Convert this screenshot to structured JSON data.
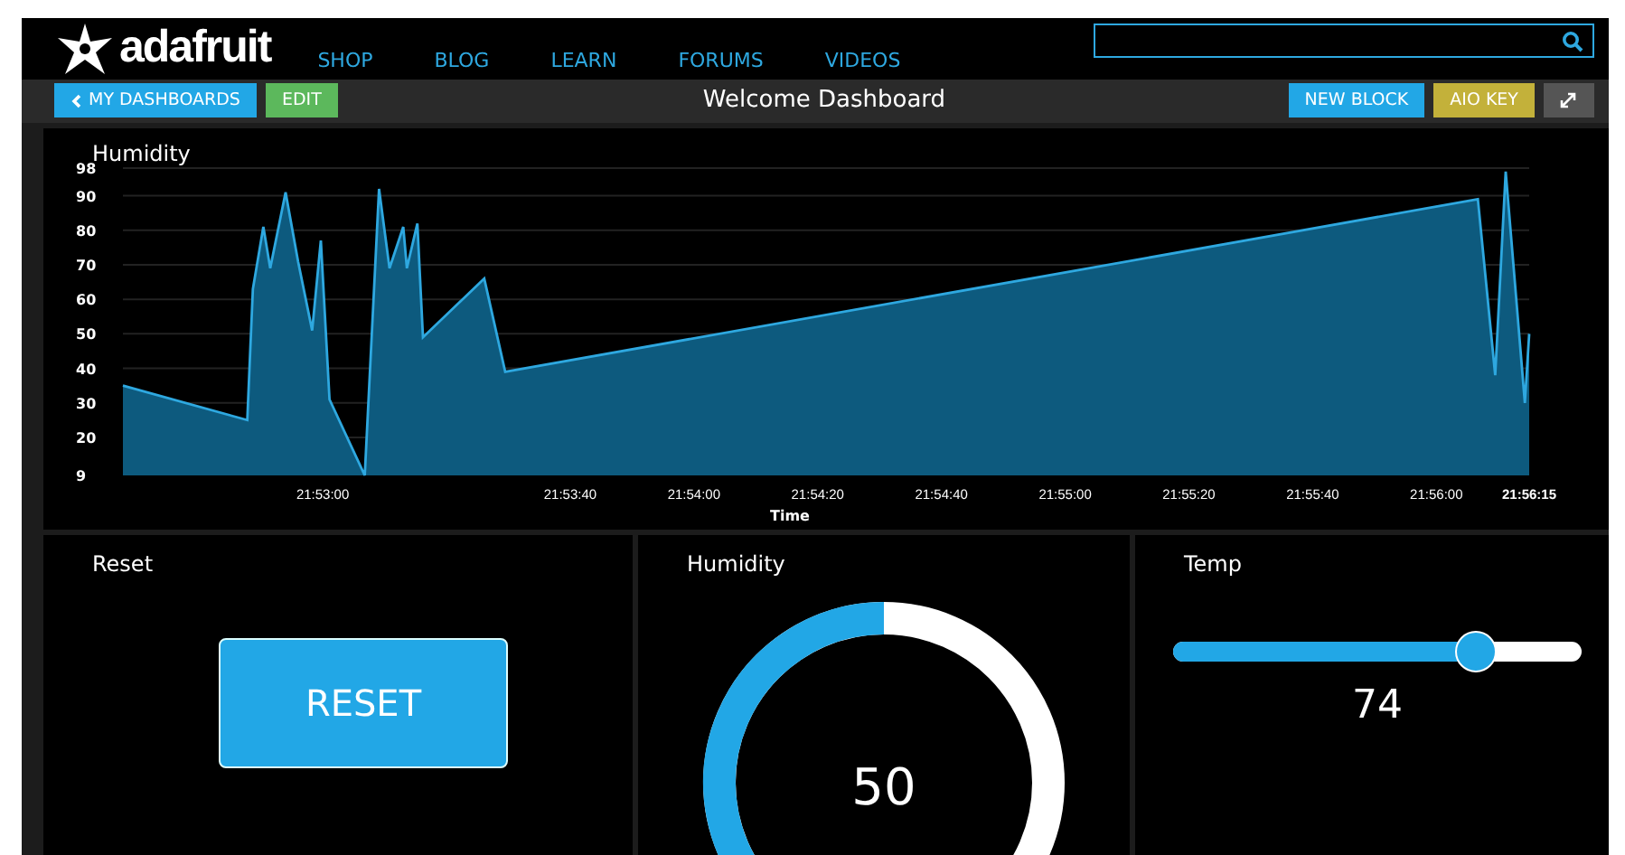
{
  "header": {
    "logo": "adafruit",
    "nav": [
      "SHOP",
      "BLOG",
      "LEARN",
      "FORUMS",
      "VIDEOS"
    ]
  },
  "toolbar": {
    "left_buttons": [
      {
        "label": "MY DASHBOARDS",
        "kind": "back",
        "color": "#22a7e6"
      },
      {
        "label": "EDIT",
        "kind": "plain",
        "color": "#5cb85c"
      }
    ],
    "title": "Welcome Dashboard",
    "right_buttons": [
      {
        "label": "NEW BLOCK",
        "kind": "plain",
        "color": "#22a7e6"
      },
      {
        "label": "AIO KEY",
        "kind": "plain",
        "color": "#c3b13a"
      },
      {
        "kind": "expand",
        "color": "#555555"
      }
    ]
  },
  "chart_block": {
    "chart_data": {
      "type": "area",
      "title": "Humidity",
      "xlabel": "Time",
      "grid": true,
      "xlim": [
        78747.7,
        78975
      ],
      "ylim": [
        9,
        98
      ],
      "yticks": [
        9,
        20,
        30,
        40,
        50,
        60,
        70,
        80,
        90,
        98
      ],
      "xticks": [
        {
          "value": 78780,
          "label": "21:53:00"
        },
        {
          "value": 78820,
          "label": "21:53:40"
        },
        {
          "value": 78840,
          "label": "21:54:00"
        },
        {
          "value": 78860,
          "label": "21:54:20"
        },
        {
          "value": 78880,
          "label": "21:54:40"
        },
        {
          "value": 78900,
          "label": "21:55:00"
        },
        {
          "value": 78920,
          "label": "21:55:20"
        },
        {
          "value": 78940,
          "label": "21:55:40"
        },
        {
          "value": 78960,
          "label": "21:56:00"
        },
        {
          "value": 78975,
          "label": "21:56:15"
        }
      ],
      "x": [
        78747.7,
        78767.8,
        78768.7,
        78770.4,
        78771.5,
        78774.0,
        78776.0,
        78778.3,
        78779.7,
        78781.1,
        78786.8,
        78789.1,
        78790.8,
        78793.0,
        78793.6,
        78795.3,
        78796.2,
        78806.1,
        78809.5,
        78966.7,
        78969.5,
        78971.2,
        78974.3,
        78975
      ],
      "series": [
        {
          "color": "#2ea8e0",
          "values": [
            35,
            25,
            63,
            81,
            69,
            91,
            71,
            51,
            77,
            31,
            9,
            92,
            69,
            81,
            69,
            82,
            49,
            66,
            39,
            89,
            38,
            97,
            30,
            50
          ]
        }
      ]
    }
  },
  "blocks": [
    {
      "kind": "button",
      "title": "Reset",
      "label": "RESET"
    },
    {
      "kind": "gauge",
      "title": "Humidity",
      "reading": "50"
    },
    {
      "kind": "slider",
      "title": "Temp",
      "level": 0.74,
      "reading": "74"
    }
  ]
}
